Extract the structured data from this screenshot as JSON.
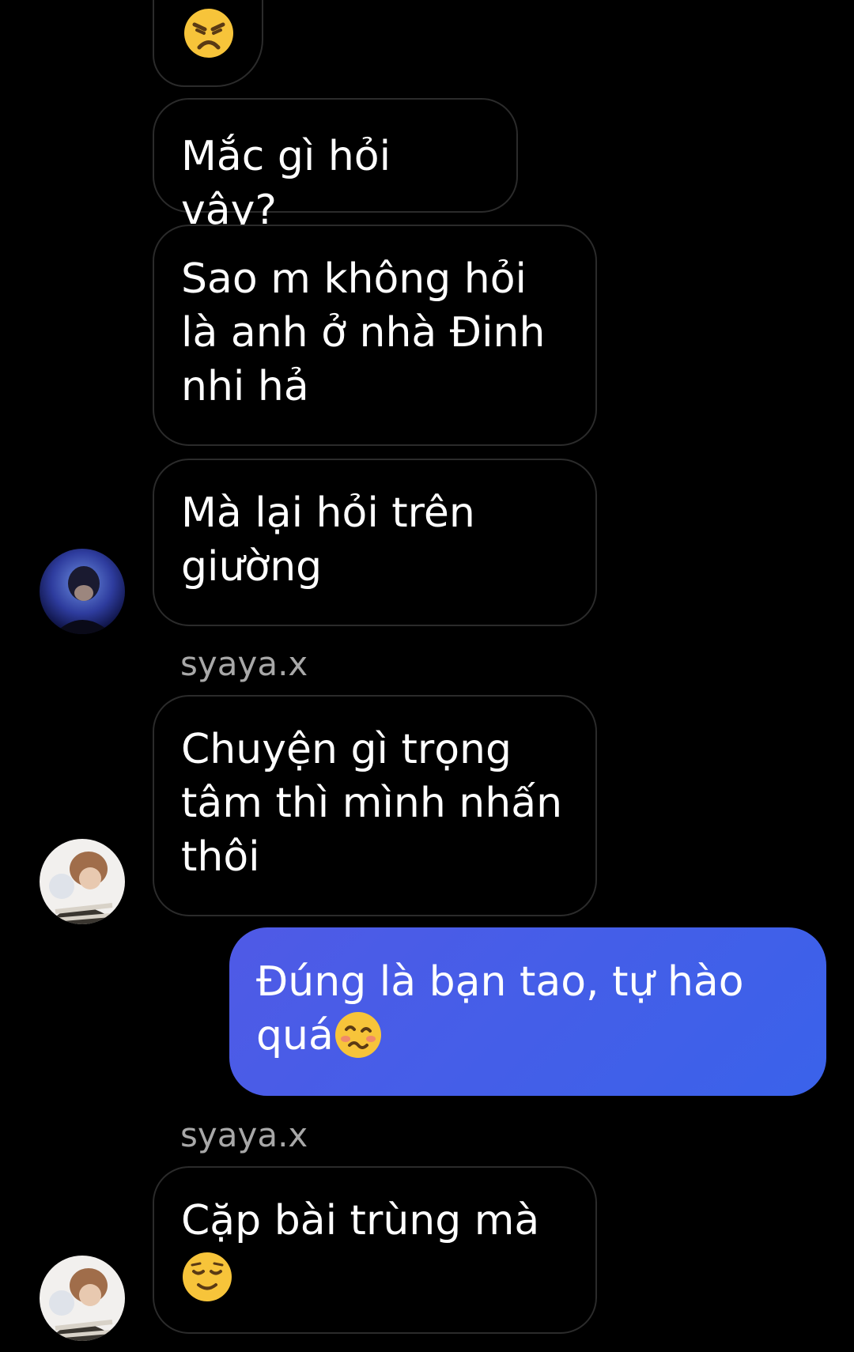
{
  "messages": [
    {
      "text": ""
    },
    {
      "text": "Mắc gì hỏi vậy?"
    },
    {
      "text": "Sao m không hỏi là anh ở nhà Đinh nhi hả"
    },
    {
      "text": "Mà lại hỏi trên giường"
    },
    {
      "sender": "syaya.x",
      "text": "Chuyện gì trọng tâm thì mình nhấn thôi"
    },
    {
      "text": "Đúng là bạn tao, tự hào quá"
    },
    {
      "sender": "syaya.x",
      "text": "Cặp bài trùng mà"
    }
  ],
  "icons": [
    "persevering-face-emoji",
    "woozy-face-emoji",
    "relieved-face-emoji",
    "avatar"
  ],
  "colors": {
    "background": "#000000",
    "my_bubble": "#4358e6",
    "their_border": "#2b2b2b",
    "sender_name": "#a8a8a8"
  }
}
